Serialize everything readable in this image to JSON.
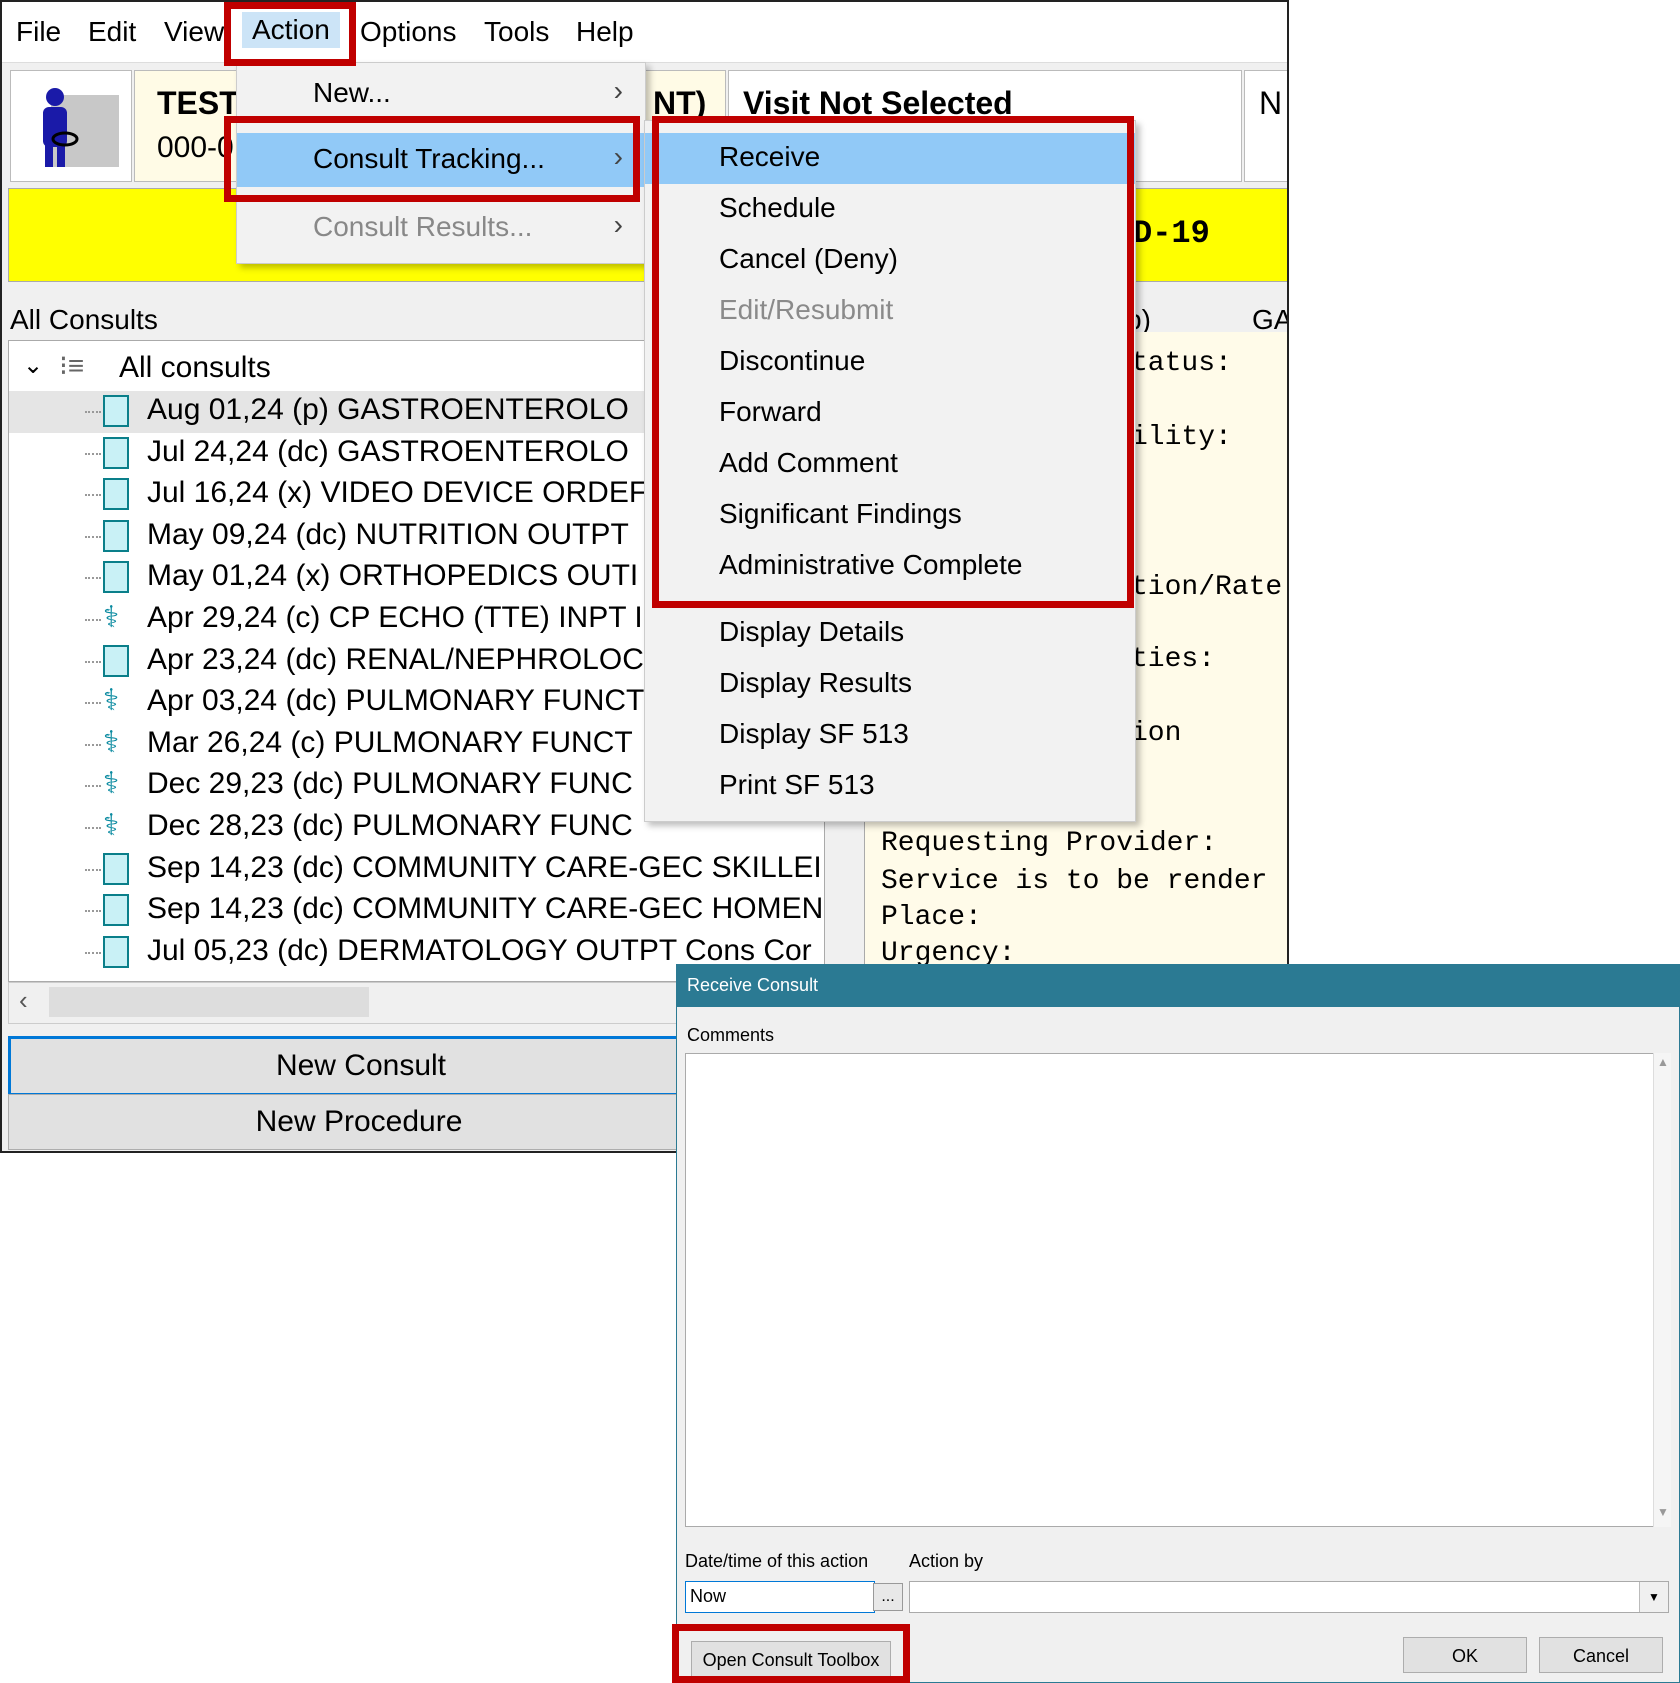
{
  "menubar": {
    "items": [
      "File",
      "Edit",
      "View",
      "Action",
      "Options",
      "Tools",
      "Help"
    ]
  },
  "patient": {
    "name_partial": "TEST",
    "ssn_partial": "000-0",
    "name_suffix_partial": "NT)",
    "visit": "Visit Not Selected",
    "right_partial": "N",
    "banner_partial": "D-19"
  },
  "consults": {
    "section_label": "All Consults",
    "root_label": "All consults",
    "rows": [
      {
        "date": "Aug 01,24",
        "status": "(p)",
        "name": "GASTROENTEROLO",
        "icon": "document"
      },
      {
        "date": "Jul 24,24",
        "status": "(dc)",
        "name": "GASTROENTEROLO",
        "icon": "document"
      },
      {
        "date": "Jul 16,24",
        "status": "(x)",
        "name": "VIDEO DEVICE ORDEF",
        "icon": "document"
      },
      {
        "date": "May 09,24",
        "status": "(dc)",
        "name": "NUTRITION OUTPT",
        "icon": "document"
      },
      {
        "date": "May 01,24",
        "status": "(x)",
        "name": "ORTHOPEDICS OUTI",
        "icon": "document"
      },
      {
        "date": "Apr 29,24",
        "status": "(c)",
        "name": "CP ECHO (TTE) INPT I",
        "icon": "caduceus"
      },
      {
        "date": "Apr 23,24",
        "status": "(dc)",
        "name": "RENAL/NEPHROLOC",
        "icon": "document"
      },
      {
        "date": "Apr 03,24",
        "status": "(dc)",
        "name": "PULMONARY FUNCT",
        "icon": "caduceus"
      },
      {
        "date": "Mar 26,24",
        "status": "(c)",
        "name": "PULMONARY FUNCT",
        "icon": "caduceus"
      },
      {
        "date": "Dec 29,23",
        "status": "(dc)",
        "name": "PULMONARY FUNC",
        "icon": "caduceus"
      },
      {
        "date": "Dec 28,23",
        "status": "(dc)",
        "name": "PULMONARY FUNC",
        "icon": "caduceus"
      },
      {
        "date": "Sep 14,23",
        "status": "(dc)",
        "name": "COMMUNITY CARE-GEC SKILLEI",
        "icon": "document"
      },
      {
        "date": "Sep 14,23",
        "status": "(dc)",
        "name": "COMMUNITY CARE-GEC HOMEN",
        "icon": "document"
      },
      {
        "date": "Jul 05,23",
        "status": "(dc)",
        "name": "DERMATOLOGY OUTPT Cons Cor",
        "icon": "document"
      }
    ]
  },
  "detail": {
    "header_partial": "p)",
    "header_right": "GA",
    "lines": [
      "tatus:",
      "ility:",
      "tion/Rate",
      "ties:",
      "ion",
      "Requesting Provider:",
      "Service is to be render",
      "Place:",
      "Urgency:"
    ]
  },
  "buttons": {
    "new_consult": "New Consult",
    "new_procedure": "New Procedure"
  },
  "action_menu": {
    "items": [
      {
        "label": "New...",
        "has_submenu": true,
        "state": "normal"
      },
      {
        "label": "Consult Tracking...",
        "has_submenu": true,
        "state": "selected"
      },
      {
        "label": "Consult Results...",
        "has_submenu": true,
        "state": "disabled"
      }
    ]
  },
  "tracking_submenu": {
    "items": [
      {
        "label": "Receive",
        "state": "selected"
      },
      {
        "label": "Schedule",
        "state": "normal"
      },
      {
        "label": "Cancel (Deny)",
        "state": "normal"
      },
      {
        "label": "Edit/Resubmit",
        "state": "disabled"
      },
      {
        "label": "Discontinue",
        "state": "normal"
      },
      {
        "label": "Forward",
        "state": "normal"
      },
      {
        "label": "Add Comment",
        "state": "normal"
      },
      {
        "label": "Significant Findings",
        "state": "normal"
      },
      {
        "label": "Administrative Complete",
        "state": "normal"
      },
      {
        "label": "Display Details",
        "state": "normal"
      },
      {
        "label": "Display Results",
        "state": "normal"
      },
      {
        "label": "Display SF 513",
        "state": "normal"
      },
      {
        "label": "Print SF 513",
        "state": "normal"
      }
    ]
  },
  "dialog": {
    "title": "Receive Consult",
    "comments_label": "Comments",
    "comments_value": "",
    "date_label": "Date/time of this action",
    "date_value": "Now",
    "date_button": "...",
    "action_by_label": "Action by",
    "action_by_value": "",
    "open_toolbox": "Open Consult Toolbox",
    "ok": "OK",
    "cancel": "Cancel"
  },
  "colors": {
    "highlight": "#91c9f7",
    "annotation_red": "#c00000",
    "banner_yellow": "#ffff00",
    "dialog_title": "#2b7a93"
  }
}
